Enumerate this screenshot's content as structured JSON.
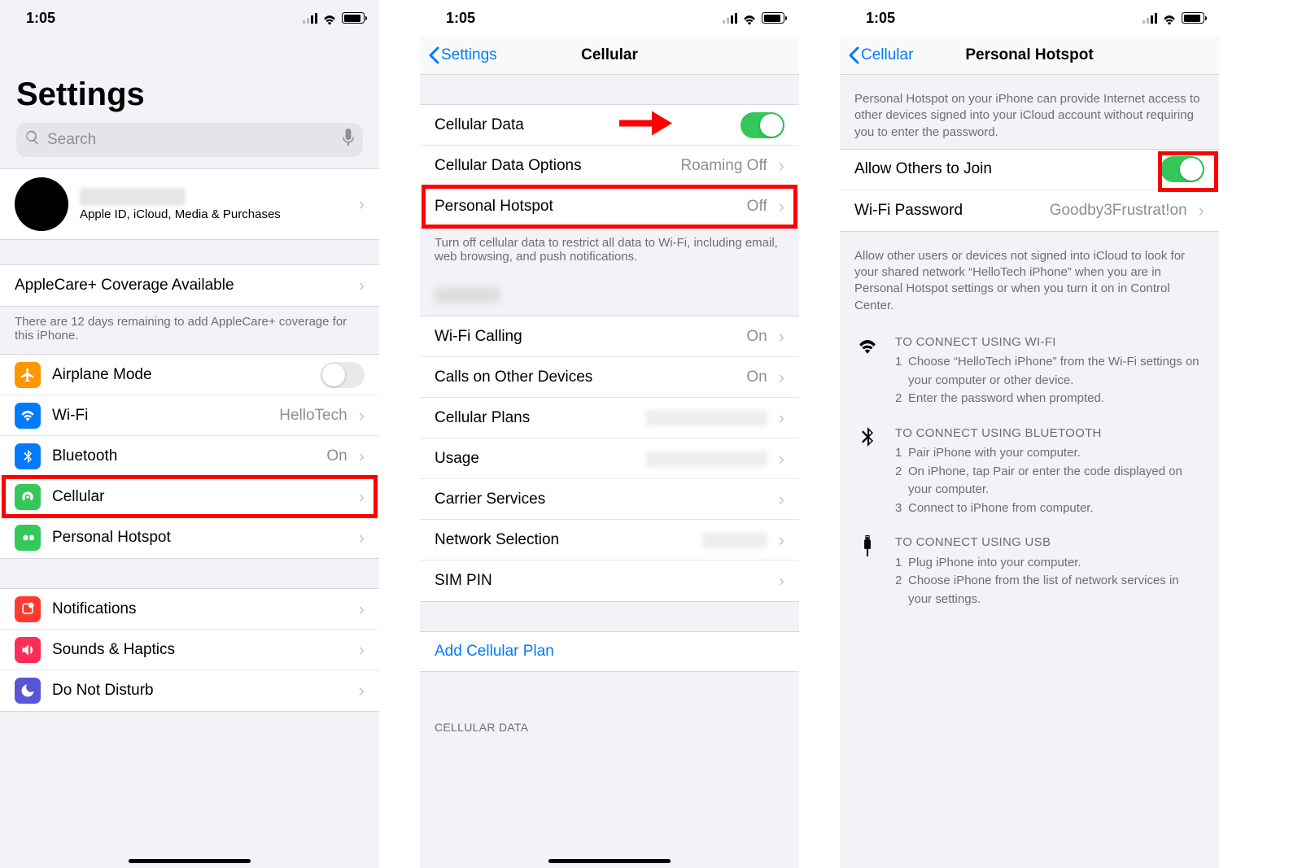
{
  "status_time": "1:05",
  "screen1": {
    "title": "Settings",
    "search_placeholder": "Search",
    "apple_id_sub": "Apple ID, iCloud, Media & Purchases",
    "applecare_label": "AppleCare+ Coverage Available",
    "applecare_note": "There are 12 days remaining to add AppleCare+ coverage for this iPhone.",
    "rows": {
      "airplane": "Airplane Mode",
      "wifi": "Wi-Fi",
      "wifi_val": "HelloTech",
      "bt": "Bluetooth",
      "bt_val": "On",
      "cellular": "Cellular",
      "hotspot": "Personal Hotspot",
      "notifications": "Notifications",
      "sounds": "Sounds & Haptics",
      "dnd": "Do Not Disturb"
    }
  },
  "screen2": {
    "back": "Settings",
    "title": "Cellular",
    "cell_data": "Cellular Data",
    "cell_opts": "Cellular Data Options",
    "cell_opts_val": "Roaming Off",
    "hotspot": "Personal Hotspot",
    "hotspot_val": "Off",
    "note": "Turn off cellular data to restrict all data to Wi-Fi, including email, web browsing, and push notifications.",
    "wifi_calling": "Wi-Fi Calling",
    "wifi_calling_val": "On",
    "calls_other": "Calls on Other Devices",
    "calls_other_val": "On",
    "cell_plans": "Cellular Plans",
    "usage": "Usage",
    "carrier": "Carrier Services",
    "net_sel": "Network Selection",
    "sim_pin": "SIM PIN",
    "add_plan": "Add Cellular Plan",
    "section_cell_data": "CELLULAR DATA"
  },
  "screen3": {
    "back": "Cellular",
    "title": "Personal Hotspot",
    "intro": "Personal Hotspot on your iPhone can provide Internet access to other devices signed into your iCloud account without requiring you to enter the password.",
    "allow": "Allow Others to Join",
    "wifi_pw": "Wi-Fi Password",
    "wifi_pw_val": "Goodby3Frustrat!on",
    "allow_note": "Allow other users or devices not signed into iCloud to look for your shared network “HelloTech iPhone” when you are in Personal Hotspot settings or when you turn it on in Control Center.",
    "wifi_title": "TO CONNECT USING WI-FI",
    "wifi_1": "Choose “HelloTech iPhone” from the Wi-Fi settings on your computer or other device.",
    "wifi_2": "Enter the password when prompted.",
    "bt_title": "TO CONNECT USING BLUETOOTH",
    "bt_1": "Pair iPhone with your computer.",
    "bt_2": "On iPhone, tap Pair or enter the code displayed on your computer.",
    "bt_3": "Connect to iPhone from computer.",
    "usb_title": "TO CONNECT USING USB",
    "usb_1": "Plug iPhone into your computer.",
    "usb_2": "Choose iPhone from the list of network services in your settings."
  }
}
